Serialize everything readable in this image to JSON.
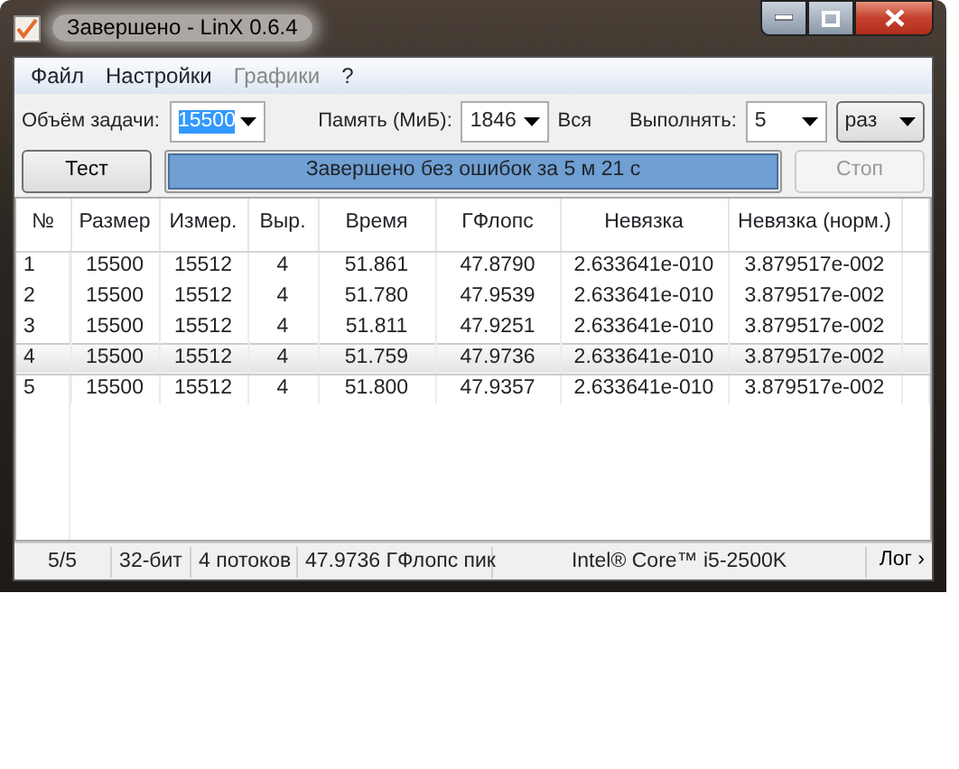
{
  "window": {
    "title": "Завершено - LinX 0.6.4"
  },
  "menu": [
    {
      "label": "Файл",
      "disabled": false
    },
    {
      "label": "Настройки",
      "disabled": false
    },
    {
      "label": "Графики",
      "disabled": true
    },
    {
      "label": "?",
      "disabled": false
    }
  ],
  "settings": {
    "task_size_label": "Объём задачи:",
    "task_size": "15500",
    "memory_label": "Память (МиБ):",
    "memory": "1846",
    "memory_note": "Вся",
    "runs_label": "Выполнять:",
    "runs": "5",
    "runs_unit": "раз"
  },
  "actions": {
    "test_button": {
      "label": "Тест",
      "disabled": false
    },
    "progress": {
      "level": 1,
      "text": "Завершено без ошибок за 5 м 21 с"
    },
    "stop_button": {
      "label": "Стоп",
      "disabled": true
    }
  },
  "table": {
    "columns": [
      "№",
      "Размер",
      "Измер.",
      "Выр.",
      "Время",
      "ГФлопс",
      "Невязка",
      "Невязка (норм.)"
    ],
    "rows": [
      {
        "selected": false,
        "cells": [
          "1",
          "15500",
          "15512",
          "4",
          "51.861",
          "47.8790",
          "2.633641e-010",
          "3.879517e-002"
        ]
      },
      {
        "selected": false,
        "cells": [
          "2",
          "15500",
          "15512",
          "4",
          "51.780",
          "47.9539",
          "2.633641e-010",
          "3.879517e-002"
        ]
      },
      {
        "selected": false,
        "cells": [
          "3",
          "15500",
          "15512",
          "4",
          "51.811",
          "47.9251",
          "2.633641e-010",
          "3.879517e-002"
        ]
      },
      {
        "selected": true,
        "cells": [
          "4",
          "15500",
          "15512",
          "4",
          "51.759",
          "47.9736",
          "2.633641e-010",
          "3.879517e-002"
        ]
      },
      {
        "selected": false,
        "cells": [
          "5",
          "15500",
          "15512",
          "4",
          "51.800",
          "47.9357",
          "2.633641e-010",
          "3.879517e-002"
        ]
      }
    ]
  },
  "status_bar": {
    "items": [
      "5/5",
      "32-бит",
      "4 потоков",
      "47.9736 ГФлопс пик",
      "Intel® Core™ i5-2500K"
    ],
    "log_button": "Лог ›"
  }
}
